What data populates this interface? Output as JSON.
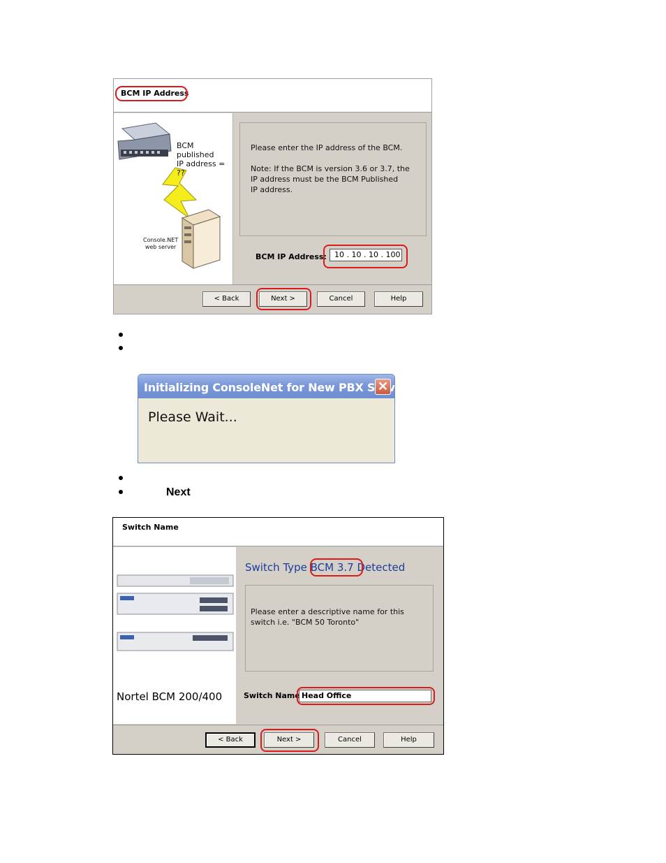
{
  "dialog1": {
    "title": "BCM IP Address",
    "illustration_labels": {
      "bcm": "BCM published\nIP address = ??",
      "server": "Console.NET\nweb server"
    },
    "message": "Please enter the IP address of the BCM.\n\nNote: If the BCM is version 3.6 or 3.7,  the\nIP address must be the BCM Published\nIP address.",
    "ip_label": "BCM IP Address:",
    "ip_value": "10 . 10 . 10 . 100",
    "buttons": {
      "back": "< Back",
      "next": "Next >",
      "cancel": "Cancel",
      "help": "Help"
    }
  },
  "dialog2": {
    "title": "Initializing ConsoleNet for New PBX Servic...",
    "close": "✕",
    "message": "Please Wait..."
  },
  "instruction": {
    "next_word": "Next"
  },
  "dialog3": {
    "title": "Switch Name",
    "illustration_caption": "Nortel BCM 200/400",
    "detected_prefix": "Switch Type",
    "detected_type": "BCM 3.7",
    "detected_suffix": "Detected",
    "message": "Please enter a descriptive name for this\nswitch i.e. \"BCM 50 Toronto\"",
    "name_label": "Switch Name:",
    "name_value": "Head Office",
    "buttons": {
      "back": "< Back",
      "next": "Next >",
      "cancel": "Cancel",
      "help": "Help"
    }
  },
  "colors": {
    "highlight": "#d81c1c",
    "dialog_bg": "#d4d0c8",
    "xp_title": "#7a98d8",
    "detect_text": "#1b3c9c"
  }
}
